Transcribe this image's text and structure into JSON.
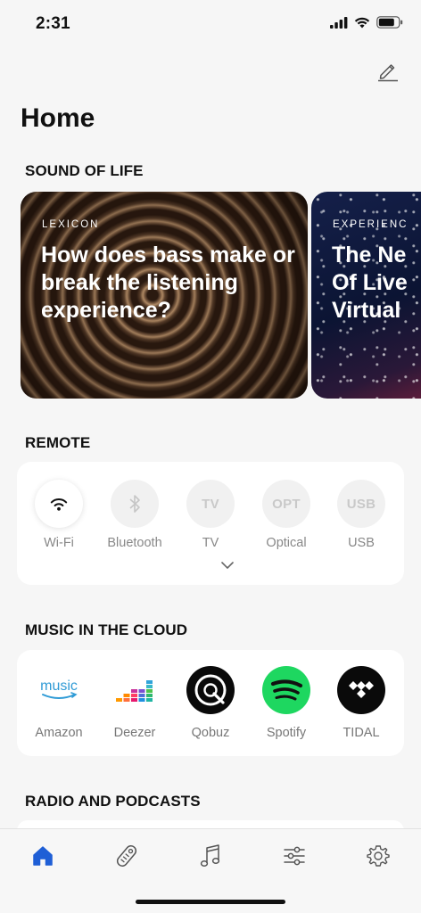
{
  "status": {
    "time": "2:31"
  },
  "header": {
    "title": "Home"
  },
  "sections": {
    "sound_of_life": "SOUND OF LIFE",
    "remote": "REMOTE",
    "cloud": "MUSIC IN THE CLOUD",
    "radio": "RADIO AND PODCASTS"
  },
  "cards": [
    {
      "tag": "LEXICON",
      "title": "How does bass make or break the listening experience?"
    },
    {
      "tag": "EXPERIENC",
      "title": "The Ne Of Live Virtual"
    }
  ],
  "remote": {
    "sources": [
      {
        "label": "Wi-Fi",
        "icon": "wifi-icon",
        "active": true
      },
      {
        "label": "Bluetooth",
        "icon": "bluetooth-icon",
        "active": false
      },
      {
        "label": "TV",
        "badge": "TV",
        "active": false
      },
      {
        "label": "Optical",
        "badge": "OPT",
        "active": false
      },
      {
        "label": "USB",
        "badge": "USB",
        "active": false
      }
    ]
  },
  "cloud": {
    "services": [
      {
        "label": "Amazon",
        "logo_text": "music",
        "icon": "amazon-music-icon"
      },
      {
        "label": "Deezer",
        "icon": "deezer-icon"
      },
      {
        "label": "Qobuz",
        "icon": "qobuz-icon"
      },
      {
        "label": "Spotify",
        "icon": "spotify-icon"
      },
      {
        "label": "TIDAL",
        "icon": "tidal-icon"
      }
    ]
  },
  "tabs": [
    "home-icon",
    "remote-icon",
    "music-icon",
    "equalizer-icon",
    "settings-icon"
  ],
  "colors": {
    "accent": "#1f5fd6",
    "spotify": "#1ed760",
    "amazon": "#2f9bd6"
  }
}
